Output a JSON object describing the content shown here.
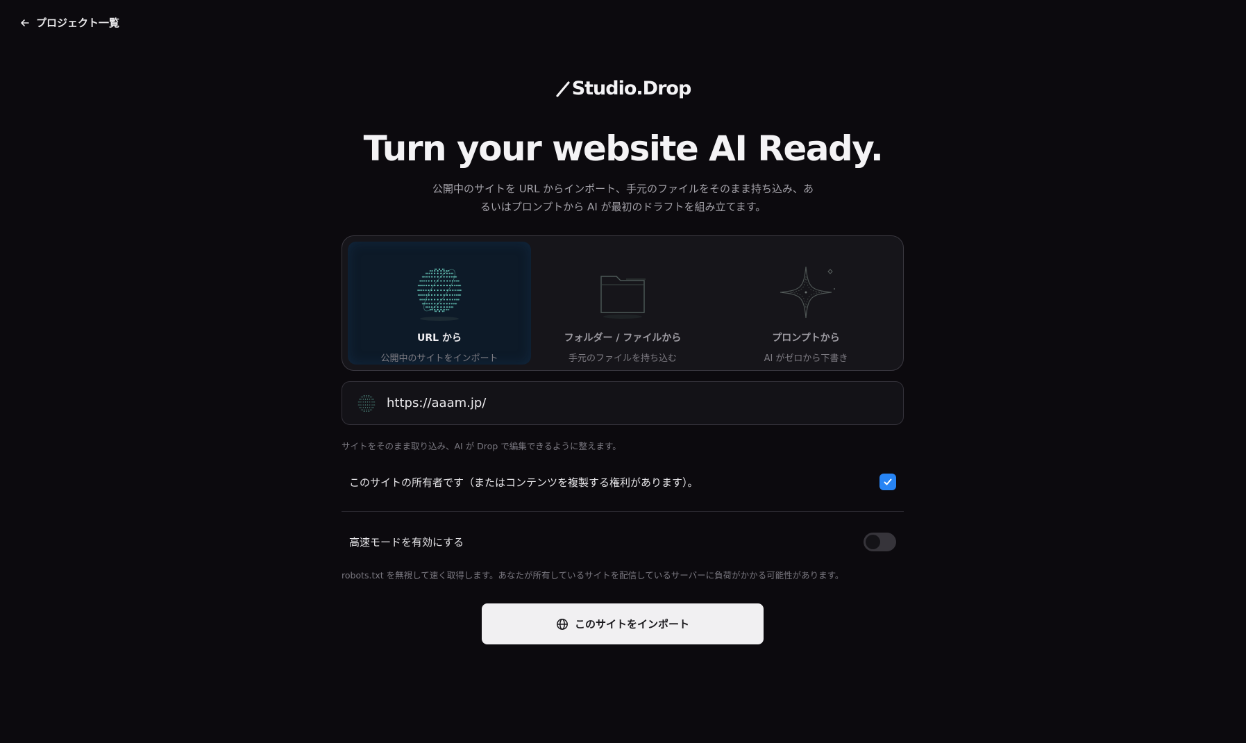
{
  "nav": {
    "back_label": "プロジェクト一覧",
    "back_icon": "arrow-left-icon"
  },
  "brand": {
    "name": "Studio.Drop"
  },
  "hero": {
    "headline": "Turn your website AI Ready.",
    "subtitle": "公開中のサイトを URL からインポート、手元のファイルをそのまま持ち込み、あるいはプロンプトから AI が最初のドラフトを組み立てます。"
  },
  "modes": [
    {
      "label": "URL から",
      "desc": "公開中のサイトをインポート",
      "icon": "globe-icon",
      "active": true
    },
    {
      "label": "フォルダー / ファイルから",
      "desc": "手元のファイルを持ち込む",
      "icon": "folder-icon",
      "active": false
    },
    {
      "label": "プロンプトから",
      "desc": "AI がゼロから下書き",
      "icon": "sparkle-icon",
      "active": false
    }
  ],
  "url_input": {
    "value": "https://aaam.jp/"
  },
  "url_hint": "サイトをそのまま取り込み、AI が Drop で編集できるように整えます。",
  "owner": {
    "label": "このサイトの所有者です（またはコンテンツを複製する権利があります）。",
    "checked": true
  },
  "fast_mode": {
    "label": "高速モードを有効にする",
    "enabled": false
  },
  "fast_hint": "robots.txt を無視して速く取得します。あなたが所有しているサイトを配信しているサーバーに負荷がかかる可能性があります。",
  "import_button": {
    "label": "このサイトをインポート",
    "icon": "globe-icon"
  },
  "colors": {
    "accent": "#2784f4",
    "background": "#0c0a0e",
    "teal": "#6fd6c6"
  }
}
